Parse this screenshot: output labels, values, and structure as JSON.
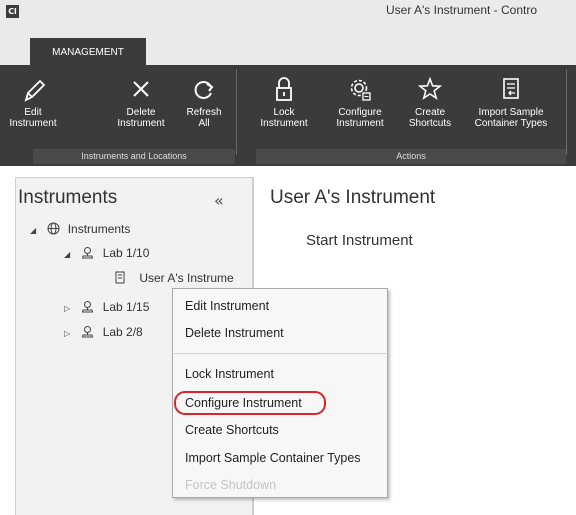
{
  "window": {
    "app_logo": "Cl",
    "title": "User A's Instrument - Contro"
  },
  "ribbon": {
    "tab": "MANAGEMENT",
    "buttons": [
      {
        "label_1": "Edit",
        "label_2": "Instrument",
        "icon": "pencil-icon"
      },
      {
        "label_1": "Delete",
        "label_2": "Instrument",
        "icon": "close-icon"
      },
      {
        "label_1": "Refresh",
        "label_2": "All",
        "icon": "refresh-icon"
      },
      {
        "label_1": "Lock",
        "label_2": "Instrument",
        "icon": "lock-icon"
      },
      {
        "label_1": "Configure",
        "label_2": "Instrument",
        "icon": "gear-icon"
      },
      {
        "label_1": "Create",
        "label_2": "Shortcuts",
        "icon": "star-icon"
      },
      {
        "label_1": "Import Sample",
        "label_2": "Container Types",
        "icon": "import-icon"
      }
    ],
    "groups": [
      "Instruments and Locations",
      "Actions"
    ]
  },
  "sidebar": {
    "title": "Instruments",
    "collapse_glyph": "«",
    "tree": [
      {
        "caret": "◢",
        "label": "Instruments",
        "icon": "globe-icon"
      },
      {
        "caret": "◢",
        "label": "Lab 1/10",
        "icon": "location-icon"
      },
      {
        "caret": "",
        "label": "User A's Instrume",
        "icon": "instrument-icon"
      },
      {
        "caret": "▷",
        "label": "Lab 1/15",
        "icon": "location-icon"
      },
      {
        "caret": "▷",
        "label": "Lab 2/8",
        "icon": "location-icon"
      }
    ]
  },
  "main": {
    "title": "User A's Instrument",
    "subtitle": "Start Instrument"
  },
  "context_menu": {
    "items": [
      {
        "label": "Edit Instrument",
        "enabled": true
      },
      {
        "label": "Delete Instrument",
        "enabled": true
      },
      {
        "label": "Lock Instrument",
        "enabled": true
      },
      {
        "label": "Configure Instrument",
        "enabled": true
      },
      {
        "label": "Create Shortcuts",
        "enabled": true
      },
      {
        "label": "Import Sample Container Types",
        "enabled": true
      },
      {
        "label": "Force Shutdown",
        "enabled": false
      }
    ]
  },
  "colors": {
    "ribbon": "#3b3b3b",
    "highlight": "#d8262b"
  }
}
